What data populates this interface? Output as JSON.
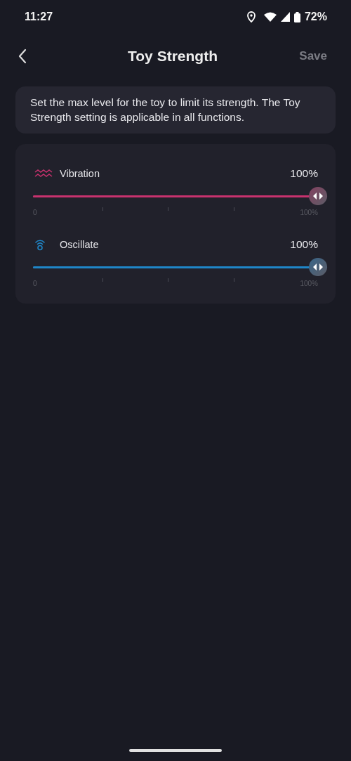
{
  "status_bar": {
    "time": "11:27",
    "battery": "72%"
  },
  "header": {
    "title": "Toy Strength",
    "save": "Save",
    "save_disabled": true
  },
  "info": "Set the max level for the toy to limit its strength. The Toy Strength setting is applicable in all functions.",
  "sliders": [
    {
      "kind": "vibration",
      "name": "Vibration",
      "reading": "100%",
      "level": 1,
      "color": "#c8326e",
      "min_label": "0",
      "max_label": "100%"
    },
    {
      "kind": "oscillate",
      "name": "Oscillate",
      "reading": "100%",
      "level": 1,
      "color": "#1f86c8",
      "min_label": "0",
      "max_label": "100%"
    }
  ]
}
